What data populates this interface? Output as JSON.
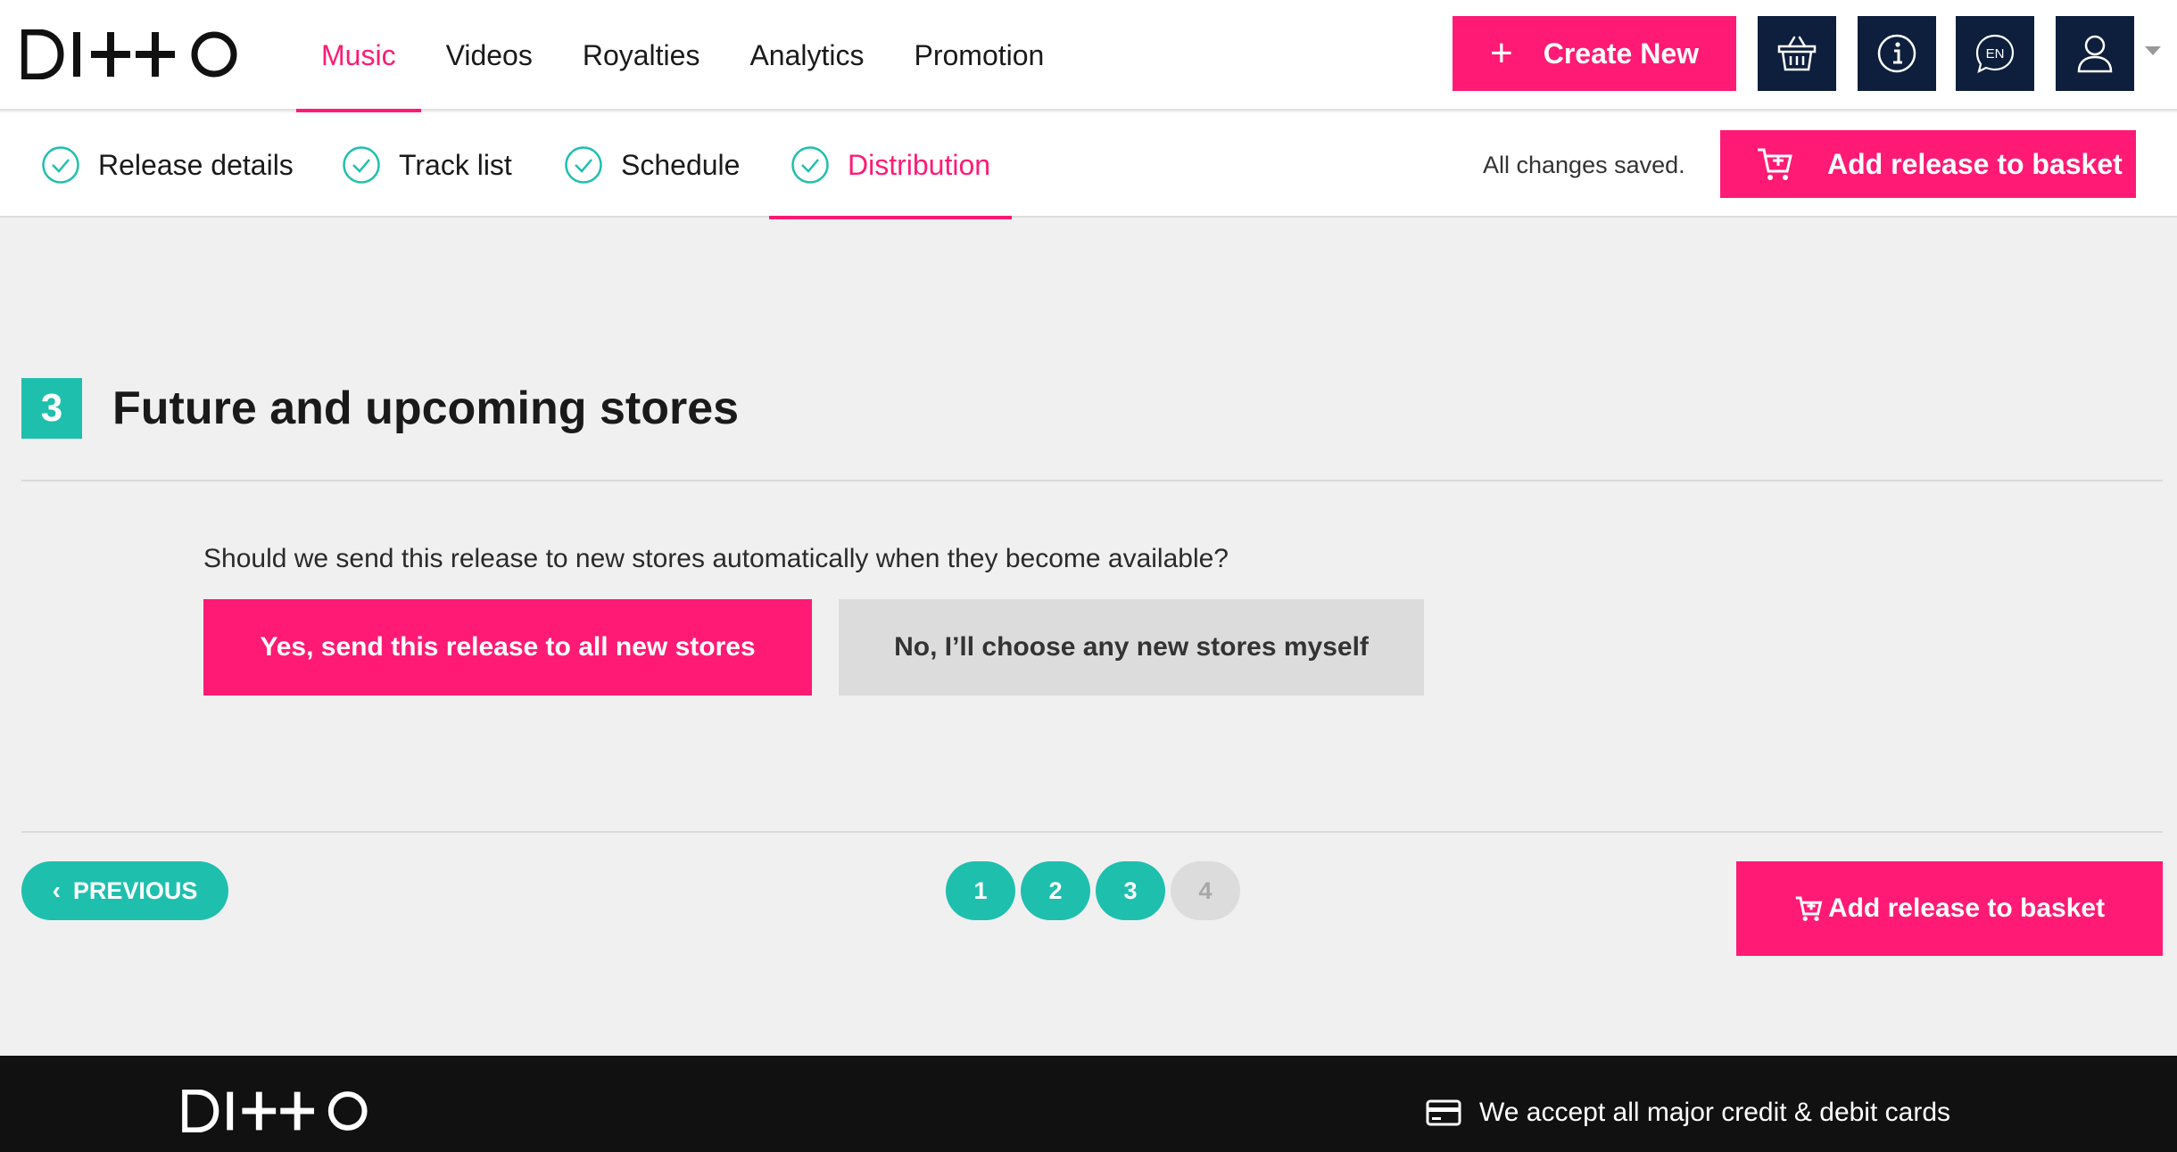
{
  "brand": {
    "logo_text": "DITTO"
  },
  "topnav": {
    "items": [
      {
        "label": "Music",
        "active": true
      },
      {
        "label": "Videos",
        "active": false
      },
      {
        "label": "Royalties",
        "active": false
      },
      {
        "label": "Analytics",
        "active": false
      },
      {
        "label": "Promotion",
        "active": false
      }
    ],
    "create_label": "Create New",
    "icons": [
      "basket-icon",
      "info-icon",
      "language-icon",
      "user-icon"
    ],
    "language_code": "EN"
  },
  "steps": {
    "items": [
      {
        "label": "Release details",
        "complete": true,
        "active": false
      },
      {
        "label": "Track list",
        "complete": true,
        "active": false
      },
      {
        "label": "Schedule",
        "complete": true,
        "active": false
      },
      {
        "label": "Distribution",
        "complete": true,
        "active": true
      }
    ],
    "saved_status": "All changes saved.",
    "basket_label": "Add release to basket"
  },
  "section": {
    "number": "3",
    "title": "Future and upcoming stores",
    "question": "Should we send this release to new stores automatically when they become available?",
    "yes_label": "Yes, send this release to all new stores",
    "no_label": "No, I’ll choose any new stores myself"
  },
  "footer_nav": {
    "previous_label": "PREVIOUS",
    "pages": [
      {
        "label": "1",
        "enabled": true
      },
      {
        "label": "2",
        "enabled": true
      },
      {
        "label": "3",
        "enabled": true
      },
      {
        "label": "4",
        "enabled": false
      }
    ],
    "basket_label": "Add release to basket"
  },
  "footer": {
    "cards_text": "We accept all major credit & debit cards"
  },
  "colors": {
    "accent": "#ff1a75",
    "teal": "#1fbfae",
    "navy": "#0e1f3d",
    "footer_bg": "#111111"
  }
}
